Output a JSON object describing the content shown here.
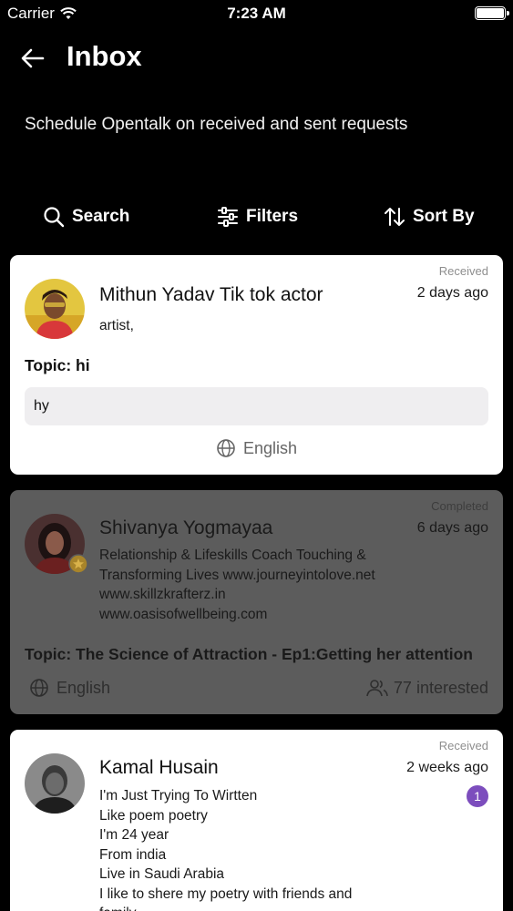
{
  "status_bar": {
    "carrier": "Carrier",
    "time": "7:23 AM"
  },
  "header": {
    "title": "Inbox",
    "subtitle": "Schedule Opentalk on received and sent requests"
  },
  "toolbar": {
    "search_label": "Search",
    "filters_label": "Filters",
    "sort_label": "Sort By"
  },
  "requests": [
    {
      "name": "Mithun Yadav Tik tok actor",
      "status": "Received",
      "time": "2 days ago",
      "bio": "artist,",
      "topic": "Topic: hi",
      "message": "hy",
      "language": "English"
    },
    {
      "name": "Shivanya Yogmayaa",
      "status": "Completed",
      "time": "6 days ago",
      "bio": [
        "Relationship & Lifeskills Coach Touching &",
        "Transforming Lives www.journeyintolove.net",
        "www.skillzkrafterz.in",
        "www.oasisofwellbeing.com"
      ],
      "topic": "Topic: The Science of Attraction - Ep1:Getting her attention",
      "language": "English",
      "interested": "77 interested"
    },
    {
      "name": "Kamal Husain",
      "status": "Received",
      "time": "2 weeks ago",
      "badge": "1",
      "bio": [
        "I'm Just Trying To Wirtten",
        "Like poem poetry",
        "I'm 24 year",
        "From india",
        "Live in Saudi Arabia",
        "I like to shere my poetry with friends and",
        "family"
      ]
    }
  ],
  "colors": {
    "background": "#000000",
    "card": "#ffffff",
    "card_dimmed": "#5c5c5c",
    "badge": "#7c4dbd",
    "message_bg": "#efeef0"
  },
  "icons": [
    "back-arrow-icon",
    "search-icon",
    "filter-sliders-icon",
    "sort-arrows-icon",
    "globe-icon",
    "people-icon",
    "star-badge-icon",
    "wifi-icon",
    "battery-icon"
  ]
}
